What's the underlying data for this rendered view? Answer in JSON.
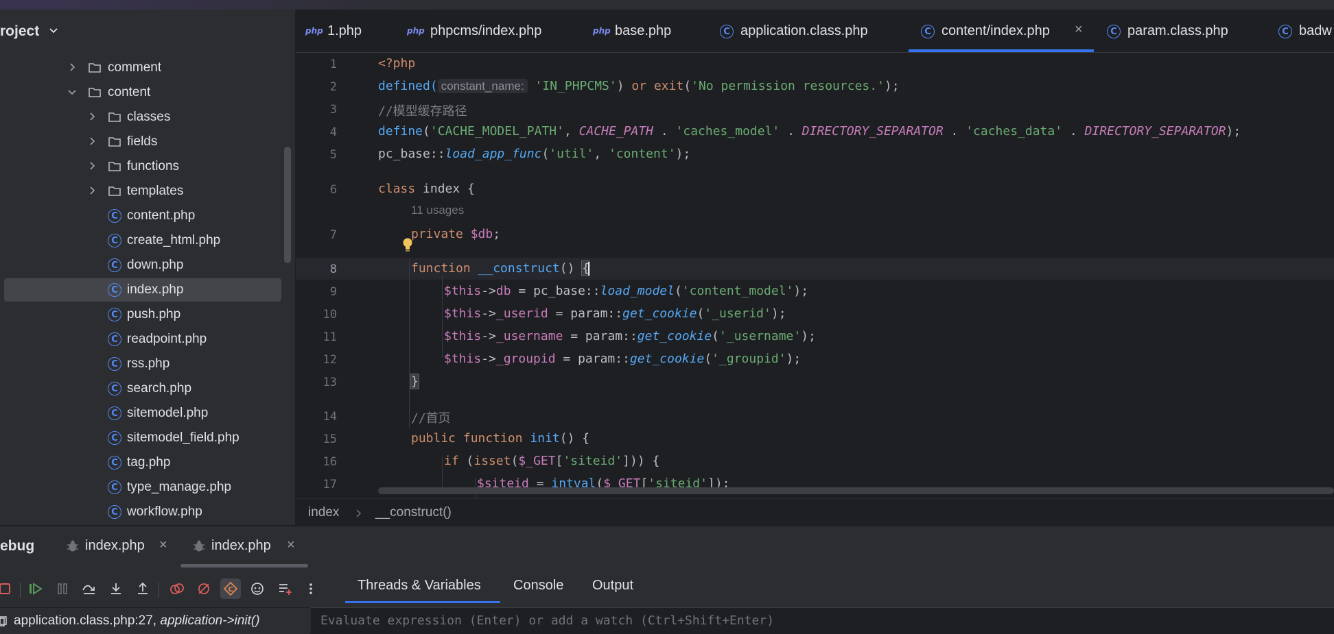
{
  "project": {
    "title": "roject",
    "items": [
      {
        "type": "folder",
        "label": "comment",
        "expanded": false
      },
      {
        "type": "folder",
        "label": "content",
        "expanded": true
      },
      {
        "type": "folder",
        "label": "classes",
        "expanded": false
      },
      {
        "type": "folder",
        "label": "fields",
        "expanded": false
      },
      {
        "type": "folder",
        "label": "functions",
        "expanded": false
      },
      {
        "type": "folder",
        "label": "templates",
        "expanded": false
      },
      {
        "type": "file",
        "label": "content.php"
      },
      {
        "type": "file",
        "label": "create_html.php"
      },
      {
        "type": "file",
        "label": "down.php"
      },
      {
        "type": "file",
        "label": "index.php",
        "selected": true
      },
      {
        "type": "file",
        "label": "push.php"
      },
      {
        "type": "file",
        "label": "readpoint.php"
      },
      {
        "type": "file",
        "label": "rss.php"
      },
      {
        "type": "file",
        "label": "search.php"
      },
      {
        "type": "file",
        "label": "sitemodel.php"
      },
      {
        "type": "file",
        "label": "sitemodel_field.php"
      },
      {
        "type": "file",
        "label": "tag.php"
      },
      {
        "type": "file",
        "label": "type_manage.php"
      },
      {
        "type": "file",
        "label": "workflow.php"
      }
    ]
  },
  "tabs": [
    {
      "label": "1.php",
      "icon": "php",
      "icon_text": "php"
    },
    {
      "label": "phpcms/index.php",
      "icon": "php",
      "icon_text": "php"
    },
    {
      "label": "base.php",
      "icon": "php",
      "icon_text": "php"
    },
    {
      "label": "application.class.php",
      "icon": "class"
    },
    {
      "label": "content/index.php",
      "icon": "class",
      "active": true,
      "close": "×"
    },
    {
      "label": "param.class.php",
      "icon": "class"
    },
    {
      "label": "badw",
      "icon": "class"
    }
  ],
  "editor": {
    "line_numbers": [
      "1",
      "2",
      "3",
      "4",
      "5",
      "6",
      "7",
      "8",
      "9",
      "10",
      "11",
      "12",
      "13",
      "14",
      "15",
      "16",
      "17"
    ],
    "current_line": "8",
    "usages_hint": "11 usages",
    "inlay_hint": "constant_name:",
    "lines": {
      "l1": "<?php",
      "l2a": "defined(",
      "l2b": "'IN_PHPCMS'",
      "l2c": ") ",
      "l2d": "or",
      "l2e": " ",
      "l2f": "exit",
      "l2g": "(",
      "l2h": "'No permission resources.'",
      "l2i": ");",
      "l3": "//模型缓存路径",
      "l4a": "define",
      "l4b": "(",
      "l4c": "'CACHE_MODEL_PATH'",
      "l4d": ", ",
      "l4e": "CACHE_PATH",
      "l4f": " . ",
      "l4g": "'caches_model'",
      "l4h": " . ",
      "l4i": "DIRECTORY_SEPARATOR",
      "l4j": " . ",
      "l4k": "'caches_data'",
      "l4l": " . ",
      "l4m": "DIRECTORY_SEPARATOR",
      "l4n": ");",
      "l5a": "pc_base::",
      "l5b": "load_app_func",
      "l5c": "(",
      "l5d": "'util'",
      "l5e": ", ",
      "l5f": "'content'",
      "l5g": ");",
      "l6a": "class",
      "l6b": " index {",
      "l7a": "private",
      "l7b": " ",
      "l7c": "$db",
      "l7d": ";",
      "l8a": "function",
      "l8b": " ",
      "l8c": "__construct",
      "l8d": "() ",
      "l8e": "{",
      "l9a": "$this",
      "l9b": "->",
      "l9c": "db",
      "l9d": " = pc_base::",
      "l9e": "load_model",
      "l9f": "(",
      "l9g": "'content_model'",
      "l9h": ");",
      "l10a": "$this",
      "l10b": "->",
      "l10c": "_userid",
      "l10d": " = param::",
      "l10e": "get_cookie",
      "l10f": "(",
      "l10g": "'_userid'",
      "l10h": ");",
      "l11a": "$this",
      "l11b": "->",
      "l11c": "_username",
      "l11d": " = param::",
      "l11e": "get_cookie",
      "l11f": "(",
      "l11g": "'_username'",
      "l11h": ");",
      "l12a": "$this",
      "l12b": "->",
      "l12c": "_groupid",
      "l12d": " = param::",
      "l12e": "get_cookie",
      "l12f": "(",
      "l12g": "'_groupid'",
      "l12h": ");",
      "l13": "}",
      "l14": "//首页",
      "l15a": "public",
      "l15b": " ",
      "l15c": "function",
      "l15d": " ",
      "l15e": "init",
      "l15f": "() {",
      "l16a": "if",
      "l16b": " (",
      "l16c": "isset",
      "l16d": "(",
      "l16e": "$_GET",
      "l16f": "[",
      "l16g": "'siteid'",
      "l16h": "])) {",
      "l17a": "$siteid",
      "l17b": " = ",
      "l17c": "intval",
      "l17d": "(",
      "l17e": "$_GET",
      "l17f": "[",
      "l17g": "'siteid'",
      "l17h": "]);"
    }
  },
  "breadcrumb": {
    "items": [
      "index",
      "__construct()"
    ]
  },
  "debug": {
    "title": "ebug",
    "sessions": [
      {
        "label": "index.php",
        "close": "×"
      },
      {
        "label": "index.php",
        "close": "×"
      }
    ],
    "toolbar_icons": [
      "stop-icon",
      "resume-icon",
      "pause-icon",
      "step-over-icon",
      "step-into-icon",
      "step-out-icon",
      "view-breakpoints-icon",
      "mute-breakpoints-icon",
      "php-class-icon",
      "settings-icon",
      "add-watch-icon",
      "more-icon"
    ],
    "panel_tabs": [
      "Threads & Variables",
      "Console",
      "Output"
    ],
    "frame_file": "application.class.php:27, ",
    "frame_method": "application->init()",
    "eval_placeholder": "Evaluate expression (Enter) or add a watch (Ctrl+Shift+Enter)"
  },
  "colors": {
    "accent": "#3574f0",
    "keyword": "#cf8e6d",
    "function": "#56a8f5",
    "string": "#6aab73",
    "variable": "#c77dbb"
  }
}
